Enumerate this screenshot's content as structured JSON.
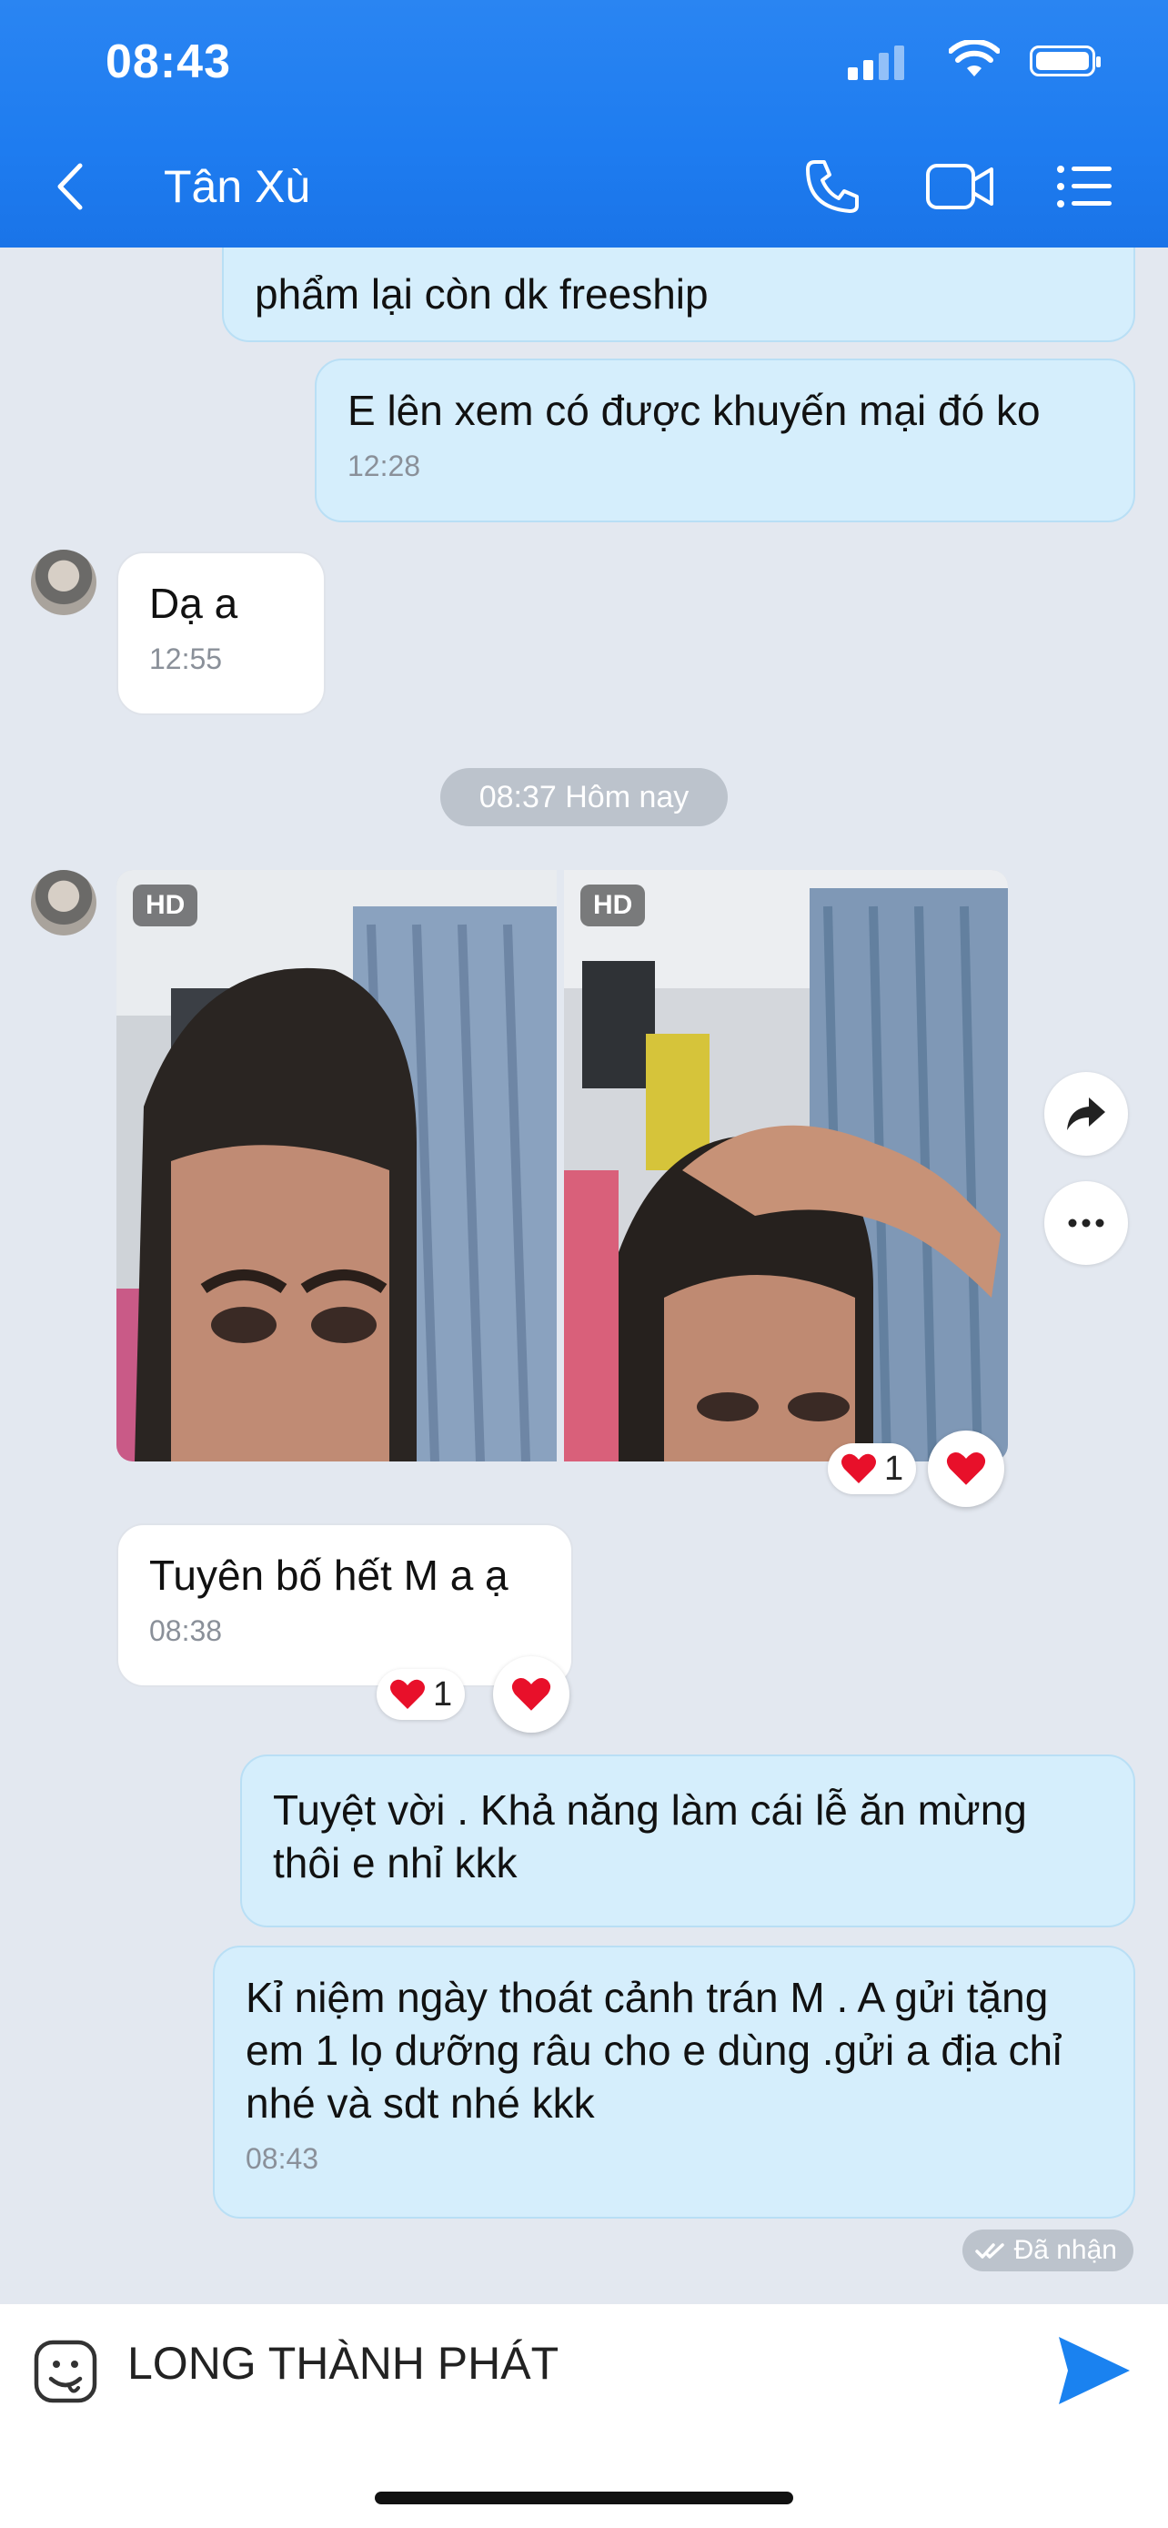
{
  "status": {
    "time": "08:43"
  },
  "header": {
    "title": "Tân Xù"
  },
  "messages": {
    "m1": {
      "text": "phẩm lại còn dk freeship"
    },
    "m2": {
      "text": "E lên xem có được khuyến mại đó ko",
      "time": "12:28"
    },
    "m3": {
      "text": "Dạ a",
      "time": "12:55"
    },
    "date_divider": "08:37 Hôm nay",
    "photos": {
      "badge": "HD",
      "reaction_count": "1"
    },
    "m4": {
      "text": "Tuyên bố hết M a ạ",
      "time": "08:38",
      "reaction_count": "1"
    },
    "m5": {
      "text": "Tuyệt vời . Khả năng làm cái lễ ăn mừng thôi e nhỉ kkk"
    },
    "m6": {
      "text": "Kỉ niệm ngày thoát cảnh trán M . A gửi tặng em 1 lọ dưỡng râu cho e dùng .gửi a địa chỉ nhé và sdt nhé kkk",
      "time": "08:43"
    },
    "receipt": "Đã nhận"
  },
  "composer": {
    "text": "LONG THÀNH PHÁT"
  },
  "icons": [
    "back-icon",
    "phone-icon",
    "video-call-icon",
    "menu-icon",
    "share-icon",
    "more-icon",
    "heart-icon",
    "sticker-icon",
    "send-icon"
  ],
  "colors": {
    "header": "#1e7cf0",
    "outgoing_bubble": "#d5eefc",
    "incoming_bubble": "#ffffff",
    "chat_bg": "#e3e8f0",
    "send": "#1a82f0",
    "heart": "#e8102a"
  }
}
